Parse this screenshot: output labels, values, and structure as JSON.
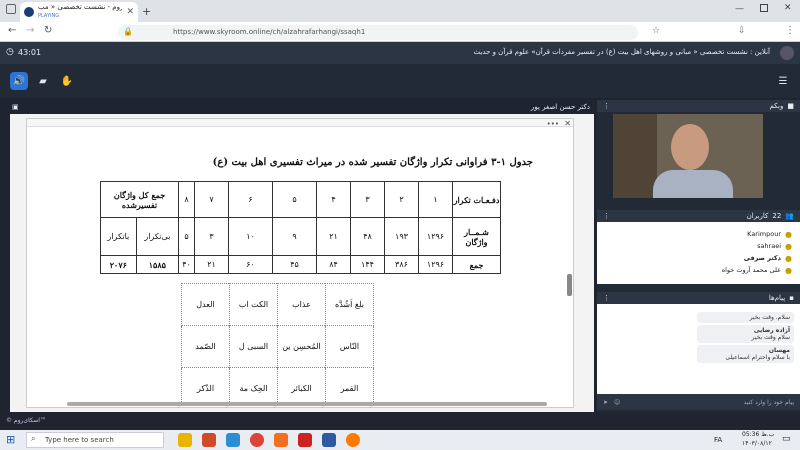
{
  "browser": {
    "tab_title": "اسکای‌روم - نشست تخصصی « مب",
    "tab_status": "PLAYING",
    "url": "https://www.skyroom.online/ch/alzahrafarhangi/ssaqh1"
  },
  "app": {
    "header_title": "آنلاین : نشست تخصصی « مبانی و روشهای اهل بیت (ع) در تفسیر مفردات قرآن» علوم قرآن و حدیث",
    "timer": "43:01"
  },
  "share": {
    "presenter": "دکتر حسن اصغر پور",
    "doc_title": "جدول ۱-۳ فراوانی تکرار واژگان تفسیر شده در میراث تفسیری اهل بیت (ع)",
    "table": {
      "row_labels": [
        "دفـعـات تکرار",
        "شـمــار واژگان",
        "جمع"
      ],
      "headers": [
        "۱",
        "۲",
        "۳",
        "۴",
        "۵",
        "۶",
        "۷",
        "۸"
      ],
      "total_header": "جمع کل واژگان تفسیرشده",
      "counts": [
        "۱۲۹۶",
        "۱۹۳",
        "۴۸",
        "۲۱",
        "۹",
        "۱۰",
        "۳",
        "۵"
      ],
      "counts_extra": [
        "بی‌تکرار",
        "باتکرار"
      ],
      "sums": [
        "۱۲۹۶",
        "۳۸۶",
        "۱۴۴",
        "۸۴",
        "۴۵",
        "۶۰",
        "۲۱",
        "۴۰"
      ],
      "sums_extra": [
        "۱۵۸۵",
        "۲۰۷۶"
      ]
    },
    "words": [
      [
        "بلغ اَشُدَّه",
        "عذاب",
        "الکت اب",
        "العدل"
      ],
      [
        "النّاس",
        "المُحسِن ین",
        "السبی ل",
        "الصّمد"
      ],
      [
        "القمر",
        "الکبائر",
        "الحِک مة",
        "الذّکر"
      ]
    ]
  },
  "side": {
    "webcam_label": "وبکم",
    "users_label": "کاربران",
    "users_count": "22",
    "users": [
      "Karimpour",
      "sahraei",
      "دکتر صرفی",
      "علی محمد آروت خواه"
    ],
    "messages_label": "پیام‌ها",
    "messages": [
      {
        "author": "",
        "text": "سلام. وقت بخیر"
      },
      {
        "author": "آزاده رضایی",
        "text": "سلام وقت بخیر"
      },
      {
        "author": "مهسان",
        "text": "با سلام واحترام اسماعیلی"
      }
    ],
    "chat_placeholder": "پیام خود را وارد کنید"
  },
  "footer": {
    "brand": "© اسکای‌روم™"
  },
  "taskbar": {
    "search_placeholder": "Type here to search",
    "time": "05:36 ب.ظ",
    "date": "۱۴۰۳/۰۸/۱۲",
    "lang": "FA"
  }
}
